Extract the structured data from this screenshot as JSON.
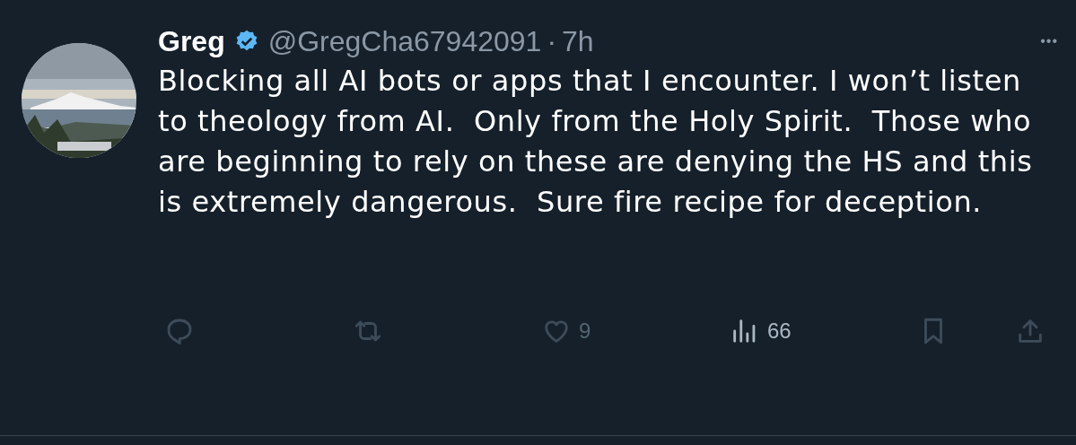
{
  "tweet": {
    "author": {
      "name": "Greg",
      "verified": true,
      "handle": "@GregCha67942091",
      "separator": "·",
      "time": "7h"
    },
    "more": "•••",
    "text": "Blocking all AI bots or apps that I encounter. I won’t listen to theology from AI.  Only from the Holy Spirit.  Those who are beginning to rely on these are denying the HS and this is extremely dangerous.  Sure fire recipe for deception.",
    "actions": [
      {
        "kind": "reply"
      },
      {
        "kind": "retweet"
      },
      {
        "kind": "like",
        "count": "9"
      },
      {
        "kind": "views",
        "count": "66"
      },
      {
        "kind": "bookmark"
      },
      {
        "kind": "share"
      }
    ]
  }
}
